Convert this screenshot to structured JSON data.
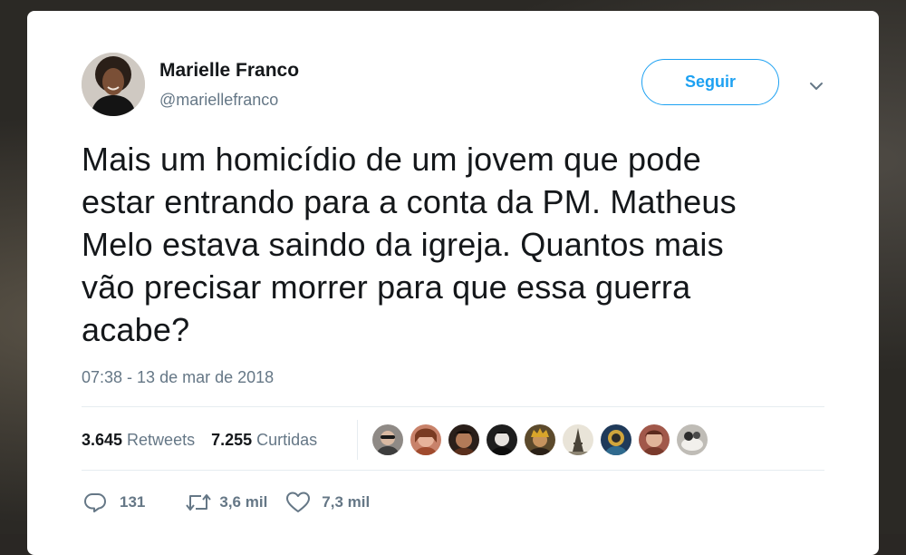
{
  "author": {
    "name": "Marielle Franco",
    "handle": "@mariellefranco"
  },
  "follow_button": {
    "label": "Seguir"
  },
  "tweet": {
    "lines": [
      "Mais um homicídio de um jovem que pode",
      "estar entrando para a conta da PM. Matheus",
      "Melo estava saindo da igreja. Quantos mais",
      "vão precisar morrer para que essa guerra",
      "acabe?"
    ],
    "timestamp": "07:38 - 13 de mar de 2018"
  },
  "stats": {
    "retweets_count": "3.645",
    "retweets_label": "Retweets",
    "likes_count": "7.255",
    "likes_label": "Curtidas"
  },
  "actions": {
    "replies": "131",
    "retweets": "3,6 mil",
    "likes": "7,3 mil"
  },
  "icons": {
    "caret": "chevron-down-icon",
    "reply": "reply-icon",
    "retweet": "retweet-icon",
    "like": "heart-icon"
  },
  "colors": {
    "accent": "#1da1f2",
    "text_primary": "#14171a",
    "text_secondary": "#657786",
    "divider": "#e6ecf0"
  },
  "likers": [
    {
      "avatar": "avatar-1"
    },
    {
      "avatar": "avatar-2"
    },
    {
      "avatar": "avatar-3"
    },
    {
      "avatar": "avatar-4"
    },
    {
      "avatar": "avatar-5"
    },
    {
      "avatar": "avatar-6"
    },
    {
      "avatar": "avatar-7"
    },
    {
      "avatar": "avatar-8"
    },
    {
      "avatar": "avatar-9"
    }
  ]
}
